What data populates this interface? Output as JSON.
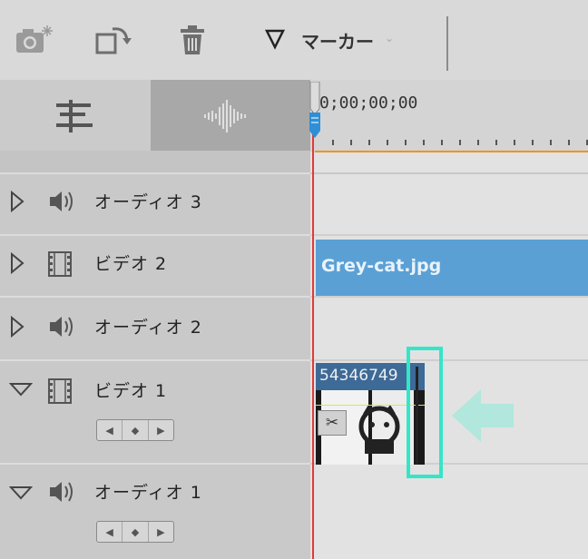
{
  "toolbar": {
    "icons": [
      "camera-icon",
      "rotate-box-icon",
      "trash-icon"
    ],
    "marker_label": "マーカー",
    "marker_dropdown_icon": "chevron-down-icon"
  },
  "header": {
    "timecode": "0;00;00;00"
  },
  "tracks": [
    {
      "name": "オーディオ 3",
      "type": "audio",
      "expanded": false
    },
    {
      "name": "ビデオ 2",
      "type": "video",
      "expanded": false
    },
    {
      "name": "オーディオ 2",
      "type": "audio",
      "expanded": false
    },
    {
      "name": "ビデオ 1",
      "type": "video",
      "expanded": true
    },
    {
      "name": "オーディオ 1",
      "type": "audio",
      "expanded": true
    }
  ],
  "clips": {
    "video2_clip": "Grey-cat.jpg",
    "video1_clip": "54346749"
  },
  "colors": {
    "clip_blue": "#5ba0d5",
    "playhead": "#e03a3a",
    "highlight": "#34e6c8",
    "timeline_orange": "#f0941e"
  }
}
